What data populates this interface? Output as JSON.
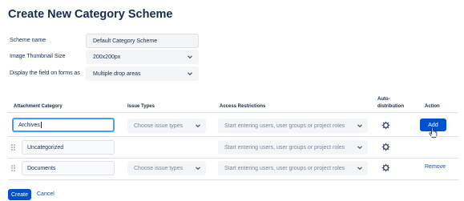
{
  "page": {
    "title": "Create New Category Scheme"
  },
  "form": {
    "scheme_name": {
      "label": "Scheme name",
      "value": "Default Category Scheme"
    },
    "thumbnail_size": {
      "label": "Image Thumbnail Size",
      "value": "200x200px"
    },
    "display_field": {
      "label": "Display the field on forms as",
      "value": "Multiple drop areas"
    }
  },
  "table": {
    "headers": {
      "category": "Attachment Category",
      "issue_types": "Issue Types",
      "access": "Access Restrictions",
      "auto_line1": "Auto-",
      "auto_line2": "distribution",
      "action": "Action"
    },
    "rows": [
      {
        "category": "Archives",
        "issue_types_placeholder": "Choose issue types",
        "access_placeholder": "Start entering users, user groups or project roles",
        "action": "Add"
      },
      {
        "category": "Uncategorized",
        "access_placeholder": "Start entering users, user groups or project roles"
      },
      {
        "category": "Documents",
        "issue_types_placeholder": "Choose issue types",
        "access_placeholder": "Start entering users, user groups or project roles",
        "action": "Remove"
      }
    ]
  },
  "footer": {
    "create_label": "Create",
    "cancel_label": "Cancel"
  },
  "icons": {
    "chevron": "chevron-down-icon",
    "gear": "gear-icon",
    "drag": "drag-handle-icon",
    "cursor": "hand-pointer-icon"
  },
  "colors": {
    "primary": "#0052cc",
    "text": "#172b4d",
    "placeholder": "#7a869a",
    "field_bg": "#f4f5f7",
    "border": "#dfe1e6",
    "focus": "#4c9aff"
  }
}
